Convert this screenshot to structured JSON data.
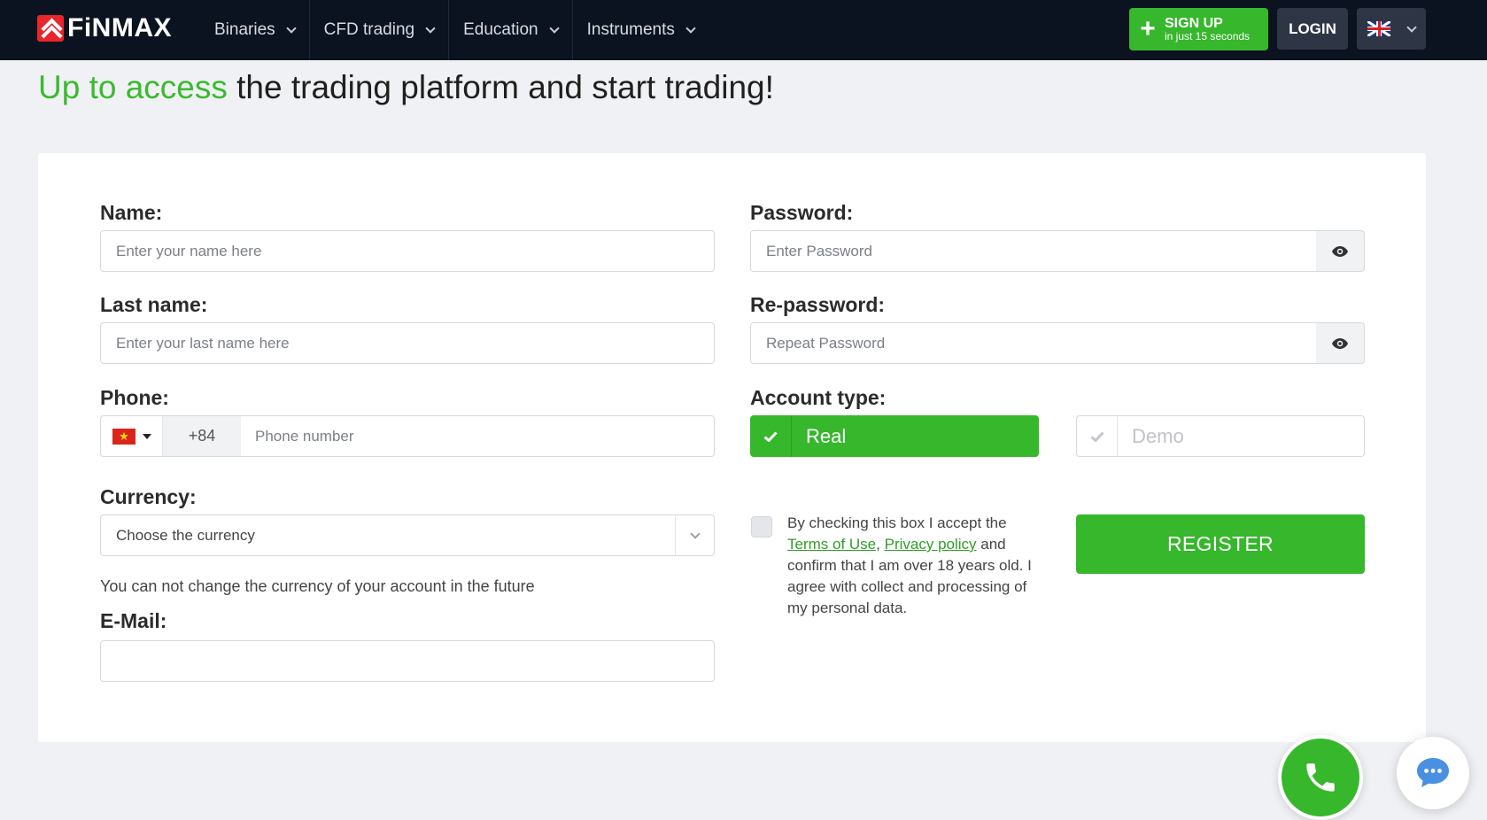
{
  "header": {
    "logo_text": "FiNMAX",
    "nav": [
      {
        "label": "Binaries"
      },
      {
        "label": "CFD trading"
      },
      {
        "label": "Education"
      },
      {
        "label": "Instruments"
      }
    ],
    "signup_main": "SIGN UP",
    "signup_sub": "in just 15 seconds",
    "login_label": "LOGIN",
    "language_icon": "uk-flag-icon"
  },
  "headline": {
    "highlight": "Up to access",
    "rest": " the trading platform and start trading!"
  },
  "form": {
    "name_label": "Name:",
    "name_placeholder": "Enter your name here",
    "lastname_label": "Last name:",
    "lastname_placeholder": "Enter your last name here",
    "phone_label": "Phone:",
    "phone_country_icon": "vietnam-flag-icon",
    "phone_code": "+84",
    "phone_placeholder": "Phone number",
    "currency_label": "Currency:",
    "currency_selected": "Choose the currency",
    "currency_note": "You can not change the currency of your account in the future",
    "email_label": "E-Mail:",
    "email_value": "",
    "password_label": "Password:",
    "password_placeholder": "Enter Password",
    "repassword_label": "Re-password:",
    "repassword_placeholder": "Repeat Password",
    "account_type_label": "Account type:",
    "account_real": "Real",
    "account_demo": "Demo",
    "account_selected": "Real",
    "agree_text_1": "By checking this box I accept the",
    "terms_link": "Terms of Use",
    "separator": ",",
    "privacy_link": "Privacy policy",
    "agree_text_2": "and confirm that I am over 18 years old. I agree with collect and processing of my personal data.",
    "agree_checked": false,
    "register_label": "REGISTER"
  },
  "floating": {
    "call_icon": "phone-icon",
    "chat_icon": "chat-bubble-icon"
  },
  "colors": {
    "accent_green": "#36b72c",
    "navbar_bg": "#0b1220",
    "brand_red": "#e8262b"
  }
}
